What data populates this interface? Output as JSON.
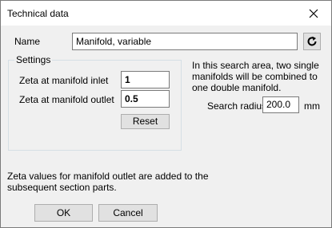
{
  "window": {
    "title": "Technical data",
    "close_icon": "close-icon"
  },
  "name_row": {
    "label": "Name",
    "value": "Manifold, variable",
    "refresh_icon": "refresh-icon"
  },
  "settings": {
    "legend": "Settings",
    "inlet_label": "Zeta at manifold inlet",
    "inlet_value": "1",
    "outlet_label": "Zeta at manifold outlet",
    "outlet_value": "0.5",
    "reset_label": "Reset"
  },
  "search": {
    "info": "In this search area, two single manifolds will be combined to one double manifold.",
    "radius_label": "Search radius",
    "radius_value": "200.0",
    "unit": "mm"
  },
  "footer": {
    "note": "Zeta values for manifold outlet are added to the subsequent section parts.",
    "ok_label": "OK",
    "cancel_label": "Cancel"
  }
}
